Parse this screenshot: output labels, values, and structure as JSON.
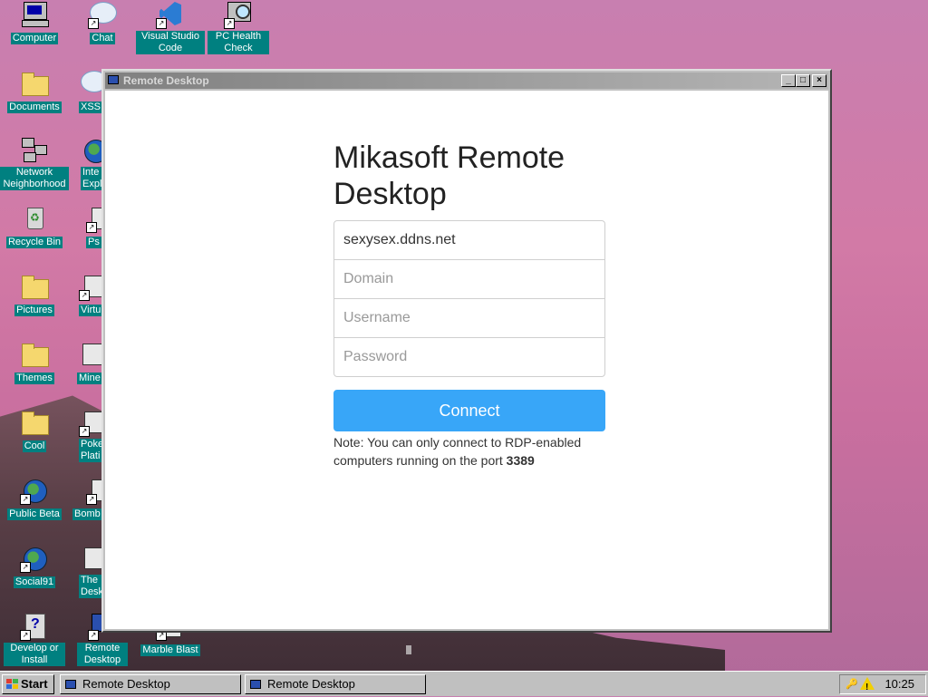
{
  "desktop": {
    "icons": [
      {
        "label": "Computer",
        "icon": "computer-icon"
      },
      {
        "label": "Chat",
        "icon": "chat-icon"
      },
      {
        "label": "Visual Studio Code",
        "icon": "vscode-icon"
      },
      {
        "label": "PC Health Check",
        "icon": "pc-health-check-icon"
      },
      {
        "label": "Documents",
        "icon": "folder-icon"
      },
      {
        "label": "XSS",
        "icon": "chat-icon"
      },
      {
        "label": "Network Neighborhood",
        "icon": "network-icon"
      },
      {
        "label": "Inte Expl",
        "icon": "internet-explorer-icon"
      },
      {
        "label": "Recycle Bin",
        "icon": "recycle-bin-icon"
      },
      {
        "label": "Ps",
        "icon": "app-icon"
      },
      {
        "label": "Pictures",
        "icon": "folder-icon"
      },
      {
        "label": "Virtu",
        "icon": "app-icon"
      },
      {
        "label": "Themes",
        "icon": "folder-icon"
      },
      {
        "label": "Mine",
        "icon": "app-icon"
      },
      {
        "label": "Cool",
        "icon": "folder-icon"
      },
      {
        "label": "Poke Plati",
        "icon": "app-icon"
      },
      {
        "label": "Public Beta",
        "icon": "globe-icon"
      },
      {
        "label": "Bomb",
        "icon": "app-icon"
      },
      {
        "label": "Social91",
        "icon": "globe-icon"
      },
      {
        "label": "The Desk",
        "icon": "app-icon"
      },
      {
        "label": "Develop or Install",
        "icon": "help-icon"
      },
      {
        "label": "Remote Desktop",
        "icon": "remote-desktop-icon"
      },
      {
        "label": "Marble Blast",
        "icon": "app-icon"
      }
    ]
  },
  "window": {
    "title": "Remote Desktop",
    "controls": {
      "minimize": "_",
      "maximize": "□",
      "close": "×"
    }
  },
  "app": {
    "heading": "Mikasoft Remote Desktop",
    "host_value": "sexysex.ddns.net",
    "domain_placeholder": "Domain",
    "username_placeholder": "Username",
    "password_placeholder": "Password",
    "connect_label": "Connect",
    "note_text": "Note: You can only connect to RDP-enabled computers running on the port ",
    "note_port": "3389"
  },
  "taskbar": {
    "start_label": "Start",
    "tasks": [
      "Remote Desktop",
      "Remote Desktop"
    ],
    "clock": "10:25"
  },
  "colors": {
    "connect_button": "#38a6f8",
    "icon_label_bg": "#008080",
    "desktop_bg": "#c87fb0"
  }
}
